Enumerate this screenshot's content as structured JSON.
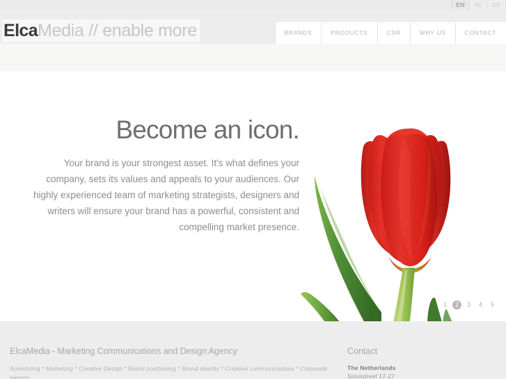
{
  "topbar": {
    "languages": [
      {
        "code": "EN",
        "active": true
      },
      {
        "code": "NL",
        "active": false
      },
      {
        "code": "DE",
        "active": false
      }
    ]
  },
  "header": {
    "logo": {
      "dark": "Elca",
      "light": "Media // enable more"
    },
    "nav": [
      {
        "label": "BRANDS"
      },
      {
        "label": "PRODUCTS"
      },
      {
        "label": "CSR"
      },
      {
        "label": "WHY US"
      },
      {
        "label": "CONTACT"
      }
    ]
  },
  "hero": {
    "title": "Become an icon.",
    "body": "Your brand is your strongest asset. It's what defines your company, sets its values and appeals to your audiences. Our highly experienced team of marketing strategists, designers and writers will ensure your brand has a powerful, consistent and compelling market presence.",
    "image_name": "red-tulip-photo",
    "pager": [
      {
        "label": "1",
        "active": false
      },
      {
        "label": "2",
        "active": true
      },
      {
        "label": "3",
        "active": false
      },
      {
        "label": "4",
        "active": false
      },
      {
        "label": "5",
        "active": false
      }
    ]
  },
  "footer": {
    "left": {
      "title": "ElcaMedia - Marketing Communications and Design Agency",
      "keywords": "Advertising * Marketing * Creative Design * Brand positioning * Brand identity * Creative communications * Corporate Identity"
    },
    "right": {
      "title": "Contact",
      "country": "The Netherlands",
      "street": "Siriusdreef 17-27"
    }
  },
  "colors": {
    "accent_red": "#d8231f",
    "stem_green": "#9cc44e",
    "leaf_green": "#4f8f3c",
    "header_gray": "#ededed",
    "text_gray": "#8d8d8d"
  }
}
